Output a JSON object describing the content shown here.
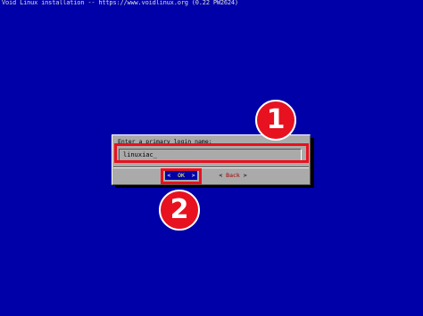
{
  "window": {
    "title": "Void Linux installation -- https://www.voidlinux.org (0.22 PW2624)"
  },
  "dialog": {
    "prompt": "Enter a primary login name:",
    "input_value": "linuxiac_",
    "buttons": {
      "ok": {
        "open": "<",
        "label": "OK",
        "close": ">"
      },
      "back": {
        "open": "<",
        "label": "Back",
        "close": ">"
      }
    }
  },
  "annotations": {
    "step1": "1",
    "step2": "2"
  },
  "colors": {
    "background": "#0000a8",
    "dialog": "#aaaaaa",
    "highlight": "#e8111f",
    "selected_button": "#0000a8"
  }
}
